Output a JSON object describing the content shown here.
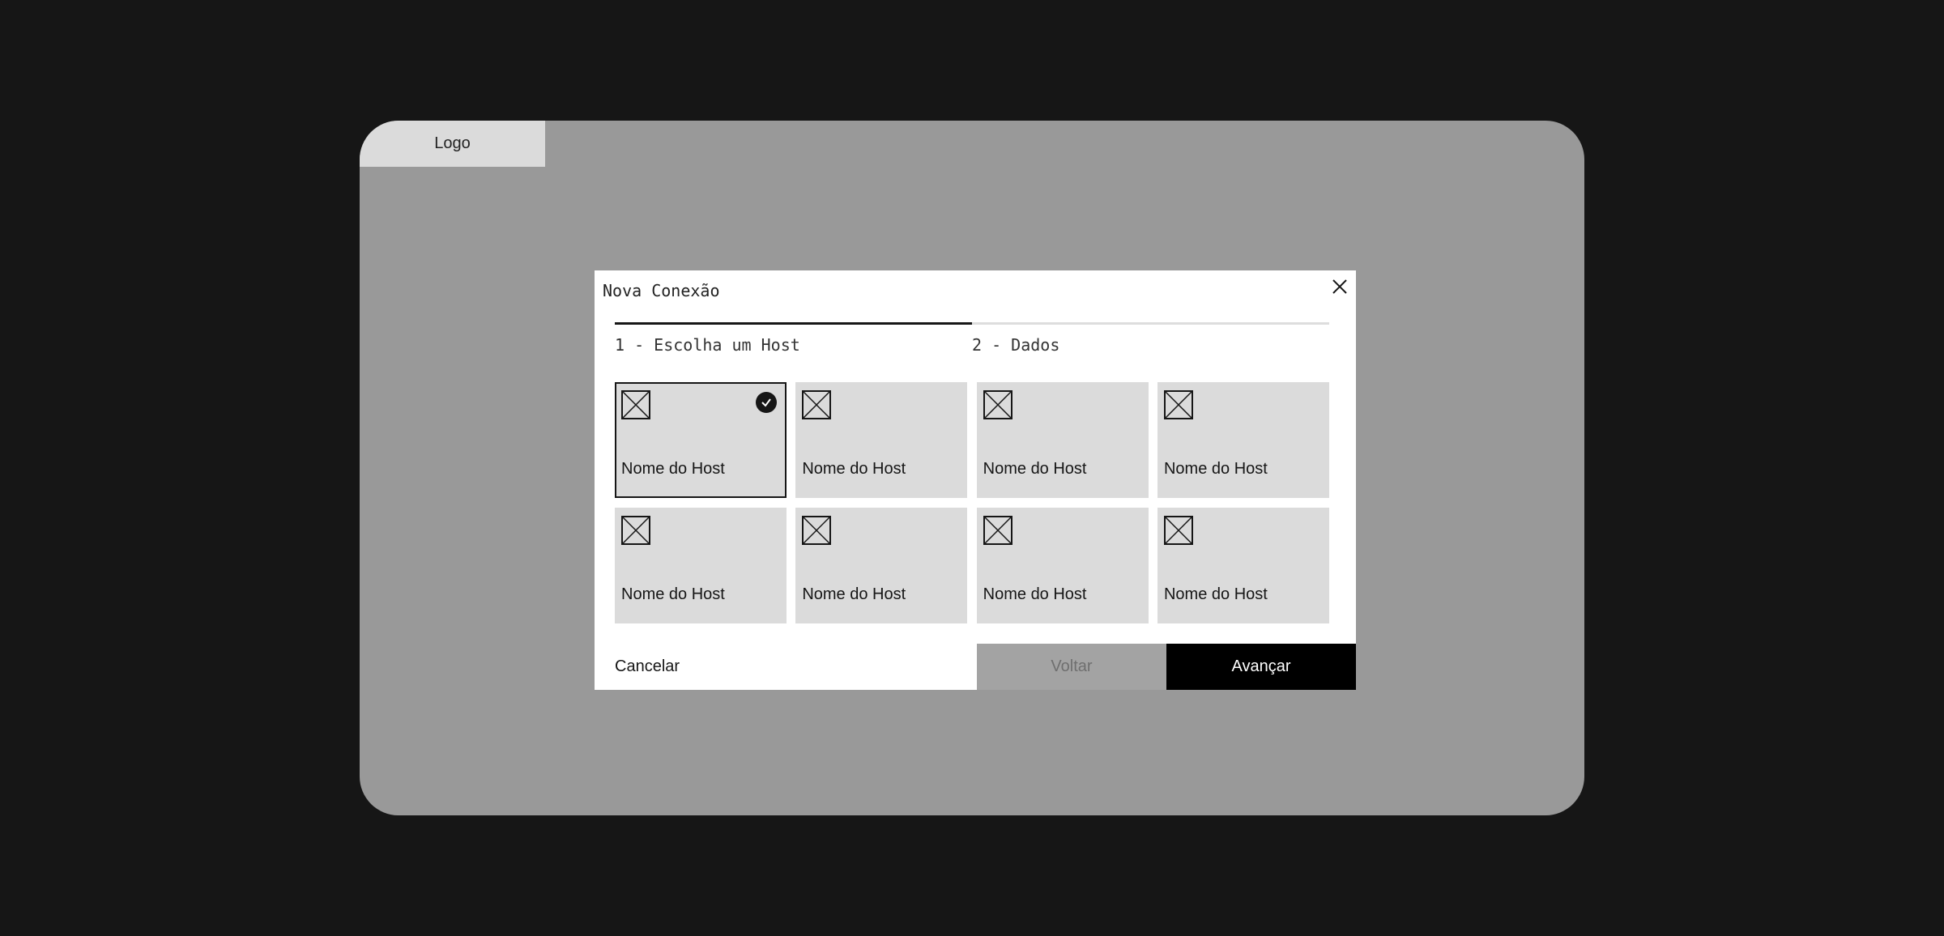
{
  "app": {
    "logo_label": "Logo"
  },
  "modal": {
    "title": "Nova Conexão",
    "close_icon": "close-icon",
    "progress_fraction": 0.5,
    "steps": [
      {
        "label": "1 - Escolha um Host",
        "active": true
      },
      {
        "label": "2 - Dados",
        "active": false
      }
    ],
    "hosts": [
      {
        "name": "Nome do Host",
        "selected": true,
        "icon": "image-placeholder-icon"
      },
      {
        "name": "Nome do Host",
        "selected": false,
        "icon": "image-placeholder-icon"
      },
      {
        "name": "Nome do Host",
        "selected": false,
        "icon": "image-placeholder-icon"
      },
      {
        "name": "Nome do Host",
        "selected": false,
        "icon": "image-placeholder-icon"
      },
      {
        "name": "Nome do Host",
        "selected": false,
        "icon": "image-placeholder-icon"
      },
      {
        "name": "Nome do Host",
        "selected": false,
        "icon": "image-placeholder-icon"
      },
      {
        "name": "Nome do Host",
        "selected": false,
        "icon": "image-placeholder-icon"
      },
      {
        "name": "Nome do Host",
        "selected": false,
        "icon": "image-placeholder-icon"
      }
    ],
    "footer": {
      "cancel_label": "Cancelar",
      "back_label": "Voltar",
      "back_disabled": true,
      "next_label": "Avançar"
    }
  },
  "colors": {
    "page_background": "#161616",
    "screen_background": "#999999",
    "card_background": "#dbdbdb",
    "accent": "#000000"
  }
}
